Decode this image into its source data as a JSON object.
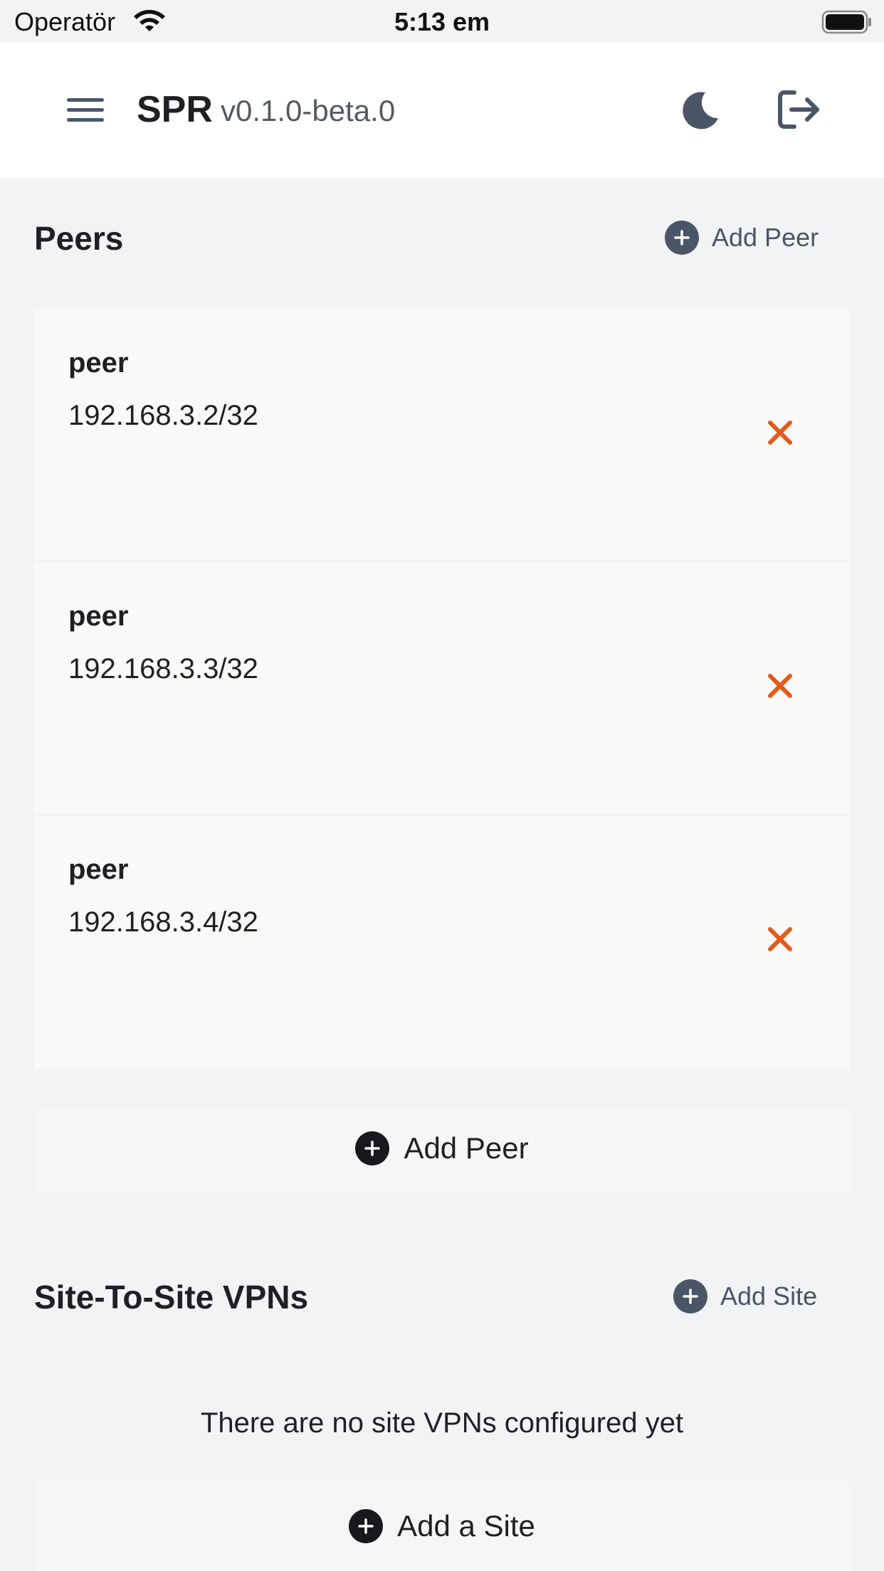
{
  "status_bar": {
    "carrier": "Operatör",
    "time": "5:13 em"
  },
  "header": {
    "brand": "SPR",
    "version": "v0.1.0-beta.0"
  },
  "peers_section": {
    "title": "Peers",
    "add_link_label": "Add Peer",
    "items": [
      {
        "name": "peer",
        "ip": "192.168.3.2/32"
      },
      {
        "name": "peer",
        "ip": "192.168.3.3/32"
      },
      {
        "name": "peer",
        "ip": "192.168.3.4/32"
      }
    ],
    "add_bar_label": "Add Peer"
  },
  "sites_section": {
    "title": "Site-To-Site VPNs",
    "add_link_label": "Add Site",
    "empty_message": "There are no site VPNs configured yet",
    "add_bar_label": "Add a Site"
  },
  "colors": {
    "delete_accent": "#e35b1a",
    "page_background": "#f2f3f5",
    "icon_slate": "#4a5566"
  },
  "icons": [
    "wifi-icon",
    "battery-icon",
    "menu-icon",
    "moon-icon",
    "logout-icon",
    "plus-circle-icon",
    "close-icon"
  ]
}
